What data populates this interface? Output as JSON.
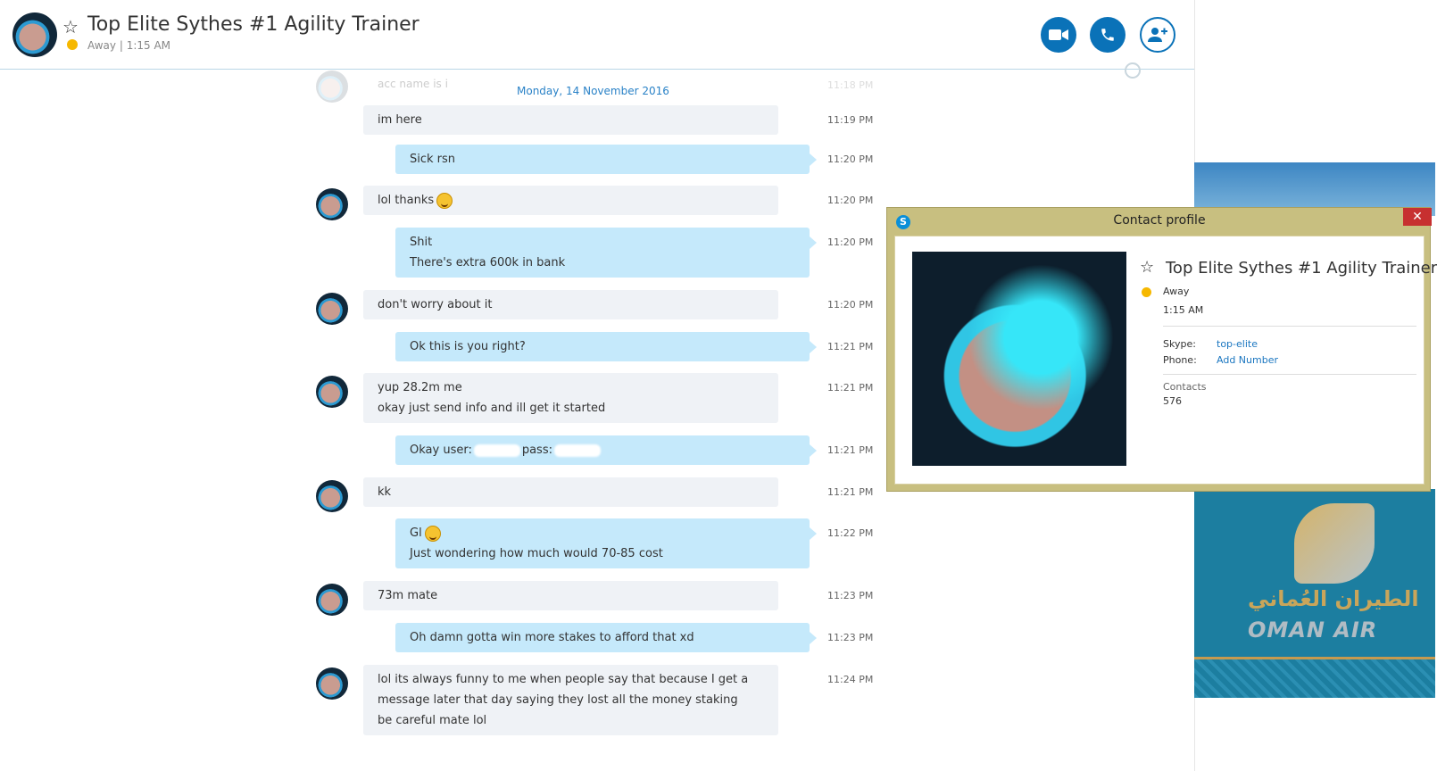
{
  "header": {
    "title": "Top Elite Sythes #1 Agility Trainer",
    "status": "Away",
    "separator": "|",
    "local_time": "1:15 AM"
  },
  "chat": {
    "ghost_text": "acc name is i",
    "ghost_time": "11:18 PM",
    "date_separator": "Monday, 14 November 2016",
    "messages": [
      {
        "dir": "in",
        "lines": [
          "im here"
        ],
        "time": "11:19 PM"
      },
      {
        "dir": "out",
        "lines": [
          "Sick rsn"
        ],
        "time": "11:20 PM"
      },
      {
        "dir": "in",
        "lines": [
          "lol thanks"
        ],
        "time": "11:20 PM",
        "emoji": "smile"
      },
      {
        "dir": "out",
        "lines": [
          "Shit",
          "There's extra 600k in bank"
        ],
        "time": "11:20 PM"
      },
      {
        "dir": "in",
        "lines": [
          "don't worry about it"
        ],
        "time": "11:20 PM"
      },
      {
        "dir": "out",
        "lines": [
          "Ok this is you right?"
        ],
        "time": "11:21 PM"
      },
      {
        "dir": "in",
        "lines": [
          "yup 28.2m me",
          "okay just send info and ill get it started"
        ],
        "time": "11:21 PM"
      },
      {
        "dir": "out",
        "lines": [
          "Okay user:",
          "pass:"
        ],
        "time": "11:21 PM"
      },
      {
        "dir": "in",
        "lines": [
          "kk"
        ],
        "time": "11:21 PM"
      },
      {
        "dir": "out",
        "lines": [
          "Gl",
          "Just wondering how much would 70-85 cost"
        ],
        "time": "11:22 PM",
        "emoji": "grin"
      },
      {
        "dir": "in",
        "lines": [
          "73m mate"
        ],
        "time": "11:23 PM"
      },
      {
        "dir": "out",
        "lines": [
          "Oh damn gotta win more stakes to afford that xd"
        ],
        "time": "11:23 PM"
      },
      {
        "dir": "in",
        "lines": [
          "lol its always funny to me when people say that because I get a",
          "message later that day saying they lost all the money staking",
          "be careful mate lol"
        ],
        "time": "11:24 PM"
      }
    ]
  },
  "popup": {
    "title": "Contact profile",
    "close": "✕",
    "name": "Top Elite Sythes #1 Agility Trainer",
    "status": "Away",
    "local_time": "1:15 AM",
    "skype_label": "Skype:",
    "skype_value": "top-elite",
    "phone_label": "Phone:",
    "phone_value": "Add Number",
    "contacts_label": "Contacts",
    "contacts_count": "576"
  },
  "ad": {
    "arabic": "الطيران العُماني",
    "brand": "OMAN AIR"
  },
  "colors": {
    "accent": "#0a72b8",
    "incoming_bubble": "#eff2f6",
    "outgoing_bubble": "#c5e9fb",
    "away": "#f6b800"
  },
  "icons": {
    "video": "video-camera-icon",
    "call": "phone-icon",
    "add": "add-contact-icon",
    "favorite": "star-icon",
    "close": "close-icon"
  }
}
